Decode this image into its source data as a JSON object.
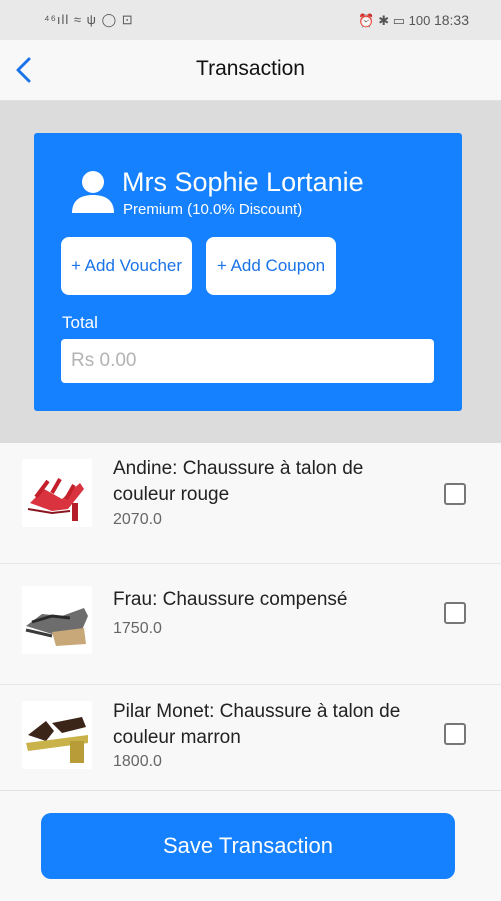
{
  "status_bar": {
    "left_icons": "⁴⁶ıll  ≈  ψ  ◯  ⊡",
    "right_icons": "⏰ ✱ ▭",
    "battery": "100",
    "time": "18:33"
  },
  "app_bar": {
    "back_icon": "chevron-left-icon",
    "title": "Transaction"
  },
  "customer": {
    "icon": "user-icon",
    "name": "Mrs Sophie Lortanie",
    "tier": "Premium (10.0% Discount)"
  },
  "actions": {
    "add_voucher": "+ Add Voucher",
    "add_coupon": "+ Add Coupon"
  },
  "total": {
    "label": "Total",
    "placeholder": "Rs 0.00"
  },
  "products": [
    {
      "name": "Andine: Chaussure à talon de couleur rouge",
      "price": "2070.0",
      "checked": false,
      "image": "red-strappy-heel"
    },
    {
      "name": "Frau: Chaussure compensé",
      "price": "1750.0",
      "checked": false,
      "image": "wedge-sandal"
    },
    {
      "name": "Pilar Monet: Chaussure à talon de couleur marron",
      "price": "1800.0",
      "checked": false,
      "image": "brown-block-heel"
    }
  ],
  "footer": {
    "save_label": "Save Transaction"
  },
  "colors": {
    "accent": "#1681FF",
    "link": "#1A73E8"
  }
}
